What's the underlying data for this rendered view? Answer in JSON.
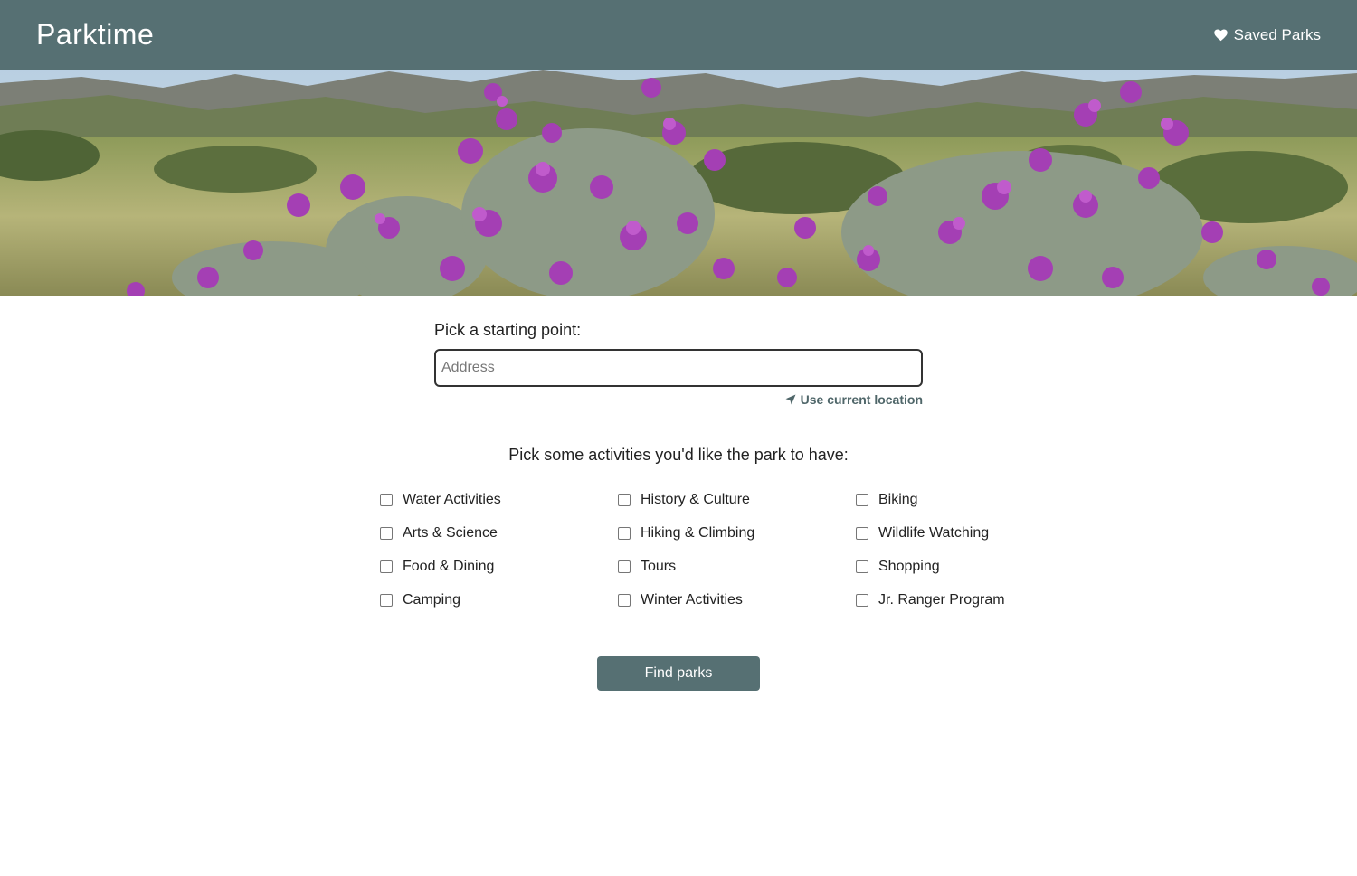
{
  "header": {
    "brand": "Parktime",
    "saved_label": "Saved Parks",
    "saved_icon": "heart-icon",
    "background_color": "#567073"
  },
  "hero": {
    "icon": "wildflower-landscape-image"
  },
  "start": {
    "label": "Pick a starting point:",
    "placeholder": "Address",
    "value": "",
    "location_label": "Use current location",
    "location_icon": "location-arrow-icon"
  },
  "activities": {
    "title": "Pick some activities you'd like the park to have:",
    "options": [
      {
        "label": "Water Activities",
        "checked": false
      },
      {
        "label": "History & Culture",
        "checked": false
      },
      {
        "label": "Biking",
        "checked": false
      },
      {
        "label": "Arts & Science",
        "checked": false
      },
      {
        "label": "Hiking & Climbing",
        "checked": false
      },
      {
        "label": "Wildlife Watching",
        "checked": false
      },
      {
        "label": "Food & Dining",
        "checked": false
      },
      {
        "label": "Tours",
        "checked": false
      },
      {
        "label": "Shopping",
        "checked": false
      },
      {
        "label": "Camping",
        "checked": false
      },
      {
        "label": "Winter Activities",
        "checked": false
      },
      {
        "label": "Jr. Ranger Program",
        "checked": false
      }
    ]
  },
  "actions": {
    "find_label": "Find parks"
  },
  "colors": {
    "accent": "#567073",
    "link": "#4f6669"
  }
}
